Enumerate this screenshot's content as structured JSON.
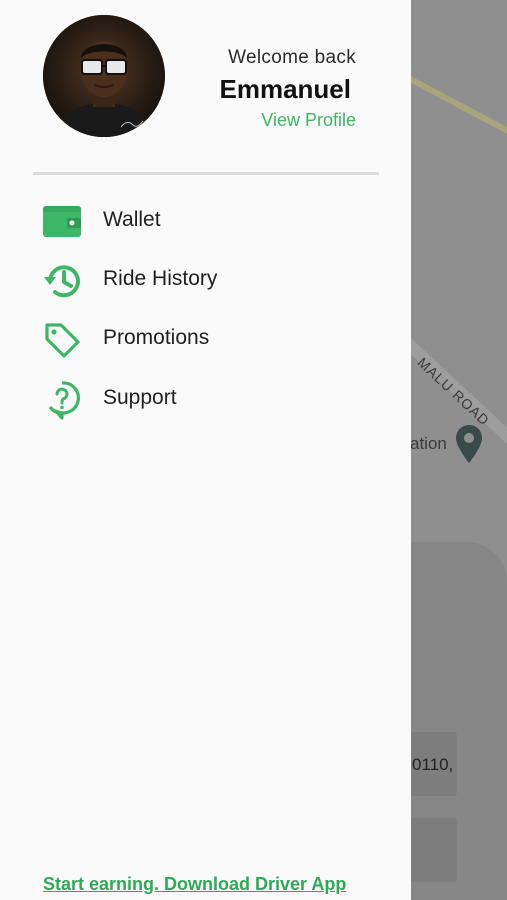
{
  "map": {
    "road_label": "MALU ROAD",
    "location_partial": "ation",
    "address_partial": "0110,"
  },
  "profile": {
    "welcome": "Welcome back",
    "name": "Emmanuel",
    "view_profile": "View Profile",
    "avatar_icon": "user-avatar"
  },
  "menu": {
    "items": [
      {
        "label": "Wallet",
        "icon": "wallet-icon"
      },
      {
        "label": "Ride History",
        "icon": "history-icon"
      },
      {
        "label": "Promotions",
        "icon": "tag-icon"
      },
      {
        "label": "Support",
        "icon": "help-icon"
      }
    ]
  },
  "footer": {
    "driver_link": "Start earning. Download Driver App "
  },
  "colors": {
    "accent": "#3db765",
    "drawer_bg": "#fafafa",
    "scrim": "#8f8f8f"
  }
}
